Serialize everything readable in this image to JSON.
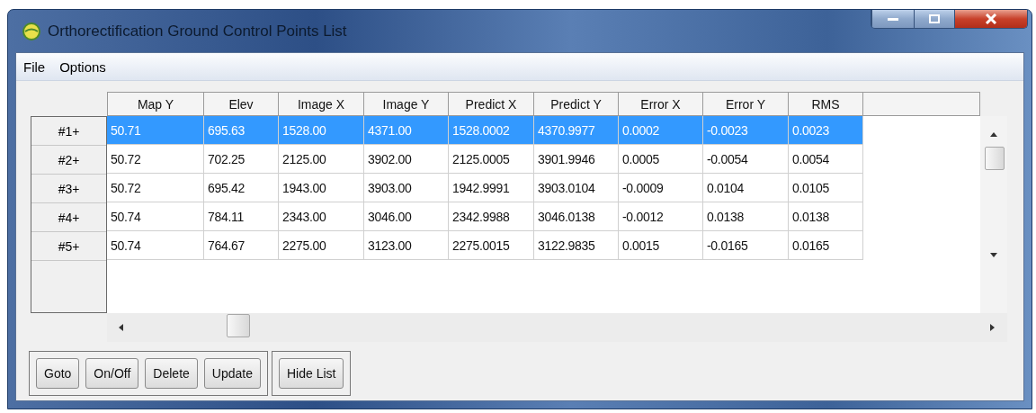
{
  "window": {
    "title": "Orthorectification Ground Control Points List"
  },
  "menu": [
    "File",
    "Options"
  ],
  "table": {
    "columns": [
      "Map Y",
      "Elev",
      "Image X",
      "Image Y",
      "Predict X",
      "Predict Y",
      "Error X",
      "Error Y",
      "RMS"
    ],
    "rows": [
      {
        "label": "#1+",
        "selected": true,
        "cells": [
          "50.71",
          "695.63",
          "1528.00",
          "4371.00",
          "1528.0002",
          "4370.9977",
          "0.0002",
          "-0.0023",
          "0.0023"
        ]
      },
      {
        "label": "#2+",
        "selected": false,
        "cells": [
          "50.72",
          "702.25",
          "2125.00",
          "3902.00",
          "2125.0005",
          "3901.9946",
          "0.0005",
          "-0.0054",
          "0.0054"
        ]
      },
      {
        "label": "#3+",
        "selected": false,
        "cells": [
          "50.72",
          "695.42",
          "1943.00",
          "3903.00",
          "1942.9991",
          "3903.0104",
          "-0.0009",
          "0.0104",
          "0.0105"
        ]
      },
      {
        "label": "#4+",
        "selected": false,
        "cells": [
          "50.74",
          "784.11",
          "2343.00",
          "3046.00",
          "2342.9988",
          "3046.0138",
          "-0.0012",
          "0.0138",
          "0.0138"
        ]
      },
      {
        "label": "#5+",
        "selected": false,
        "cells": [
          "50.74",
          "764.67",
          "2275.00",
          "3123.00",
          "2275.0015",
          "3122.9835",
          "0.0015",
          "-0.0165",
          "0.0165"
        ]
      }
    ]
  },
  "button_groups": [
    [
      "Goto",
      "On/Off",
      "Delete",
      "Update"
    ],
    [
      "Hide List"
    ]
  ]
}
